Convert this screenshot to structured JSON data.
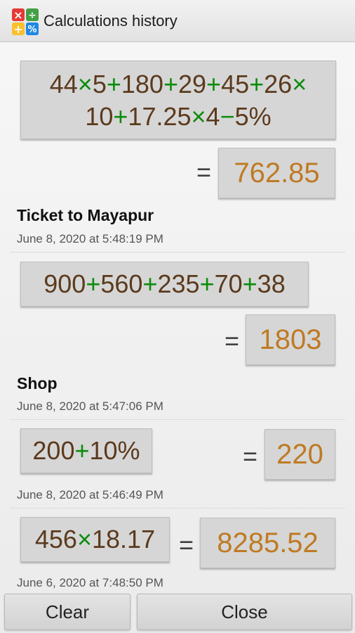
{
  "app": {
    "title": "Calculations history",
    "icon_name": "calculator-ops-icon",
    "icon_colors": [
      "#e53935",
      "#43a047",
      "#fbc02d",
      "#1e88e5"
    ]
  },
  "colors": {
    "operand": "#5b3a1d",
    "operator": "#0b8c0b",
    "result": "#bf7a23"
  },
  "entries": [
    {
      "expression_lines": [
        [
          [
            "44",
            "n"
          ],
          [
            "×",
            "o"
          ],
          [
            "5",
            "n"
          ],
          [
            "+",
            "o"
          ],
          [
            "180",
            "n"
          ],
          [
            "+",
            "o"
          ],
          [
            "29",
            "n"
          ],
          [
            "+",
            "o"
          ],
          [
            "45",
            "n"
          ],
          [
            "+",
            "o"
          ],
          [
            "26",
            "n"
          ],
          [
            "×",
            "o"
          ]
        ],
        [
          [
            "10",
            "n"
          ],
          [
            "+",
            "o"
          ],
          [
            "17.25",
            "n"
          ],
          [
            "×",
            "o"
          ],
          [
            "4",
            "n"
          ],
          [
            "−",
            "o"
          ],
          [
            "5%",
            "n"
          ]
        ]
      ],
      "equals": "=",
      "result": "762.85",
      "title": "Ticket to Mayapur",
      "date": "June 8, 2020 at 5:48:19 PM"
    },
    {
      "expression_lines": [
        [
          [
            "900",
            "n"
          ],
          [
            "+",
            "o"
          ],
          [
            "560",
            "n"
          ],
          [
            "+",
            "o"
          ],
          [
            "235",
            "n"
          ],
          [
            "+",
            "o"
          ],
          [
            "70",
            "n"
          ],
          [
            "+",
            "o"
          ],
          [
            "38",
            "n"
          ]
        ]
      ],
      "equals": "=",
      "result": "1803",
      "title": "Shop",
      "date": "June 8, 2020 at 5:47:06 PM"
    },
    {
      "expression_lines": [
        [
          [
            "200",
            "n"
          ],
          [
            "+",
            "o"
          ],
          [
            "10%",
            "n"
          ]
        ]
      ],
      "equals": "=",
      "result": "220",
      "title": "",
      "date": "June 8, 2020 at 5:46:49 PM"
    },
    {
      "expression_lines": [
        [
          [
            "456",
            "n"
          ],
          [
            "×",
            "o"
          ],
          [
            "18.17",
            "n"
          ]
        ]
      ],
      "equals": "=",
      "result": "8285.52",
      "title": "",
      "date": "June 6, 2020 at 7:48:50 PM"
    }
  ],
  "buttons": {
    "clear": "Clear",
    "close": "Close"
  }
}
